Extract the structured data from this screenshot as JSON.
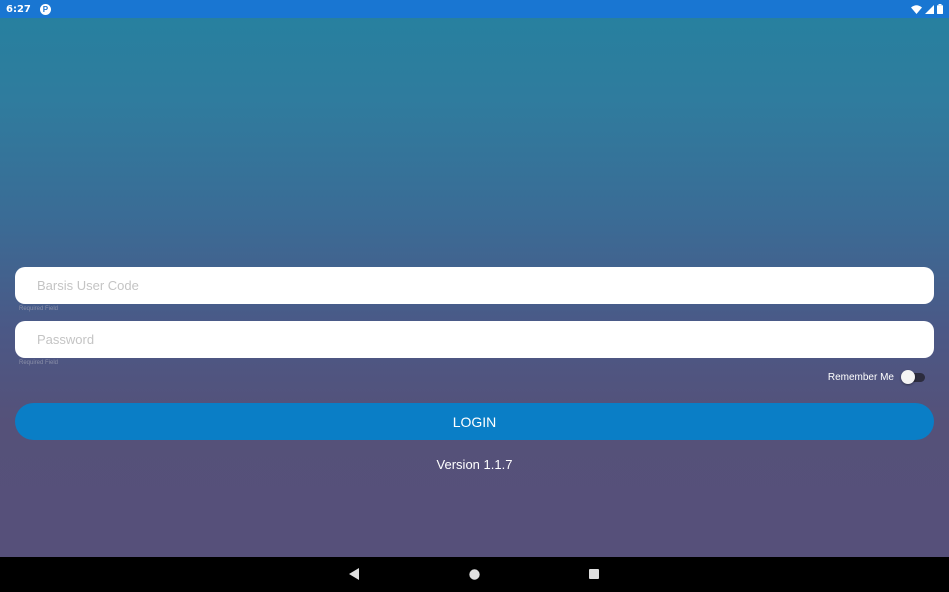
{
  "status_bar": {
    "time": "6:27",
    "app_icon_letter": "P",
    "icons": [
      "wifi-icon",
      "signal-icon",
      "battery-icon"
    ]
  },
  "login_form": {
    "user_code": {
      "placeholder": "Barsis User Code",
      "value": "",
      "hint": "Required Field"
    },
    "password": {
      "placeholder": "Password",
      "value": "",
      "hint": "Required Field"
    },
    "remember_me": {
      "label": "Remember Me",
      "checked": false
    },
    "login_label": "LOGIN"
  },
  "version_text": "Version 1.1.7",
  "nav_bar": {
    "icons": [
      "back-icon",
      "home-icon",
      "recents-icon"
    ]
  },
  "colors": {
    "status_bar": "#1976d2",
    "gradient_top": "#27809f",
    "gradient_bottom": "#56507a",
    "login_button": "#0a7ec6",
    "nav_bar": "#000000"
  }
}
